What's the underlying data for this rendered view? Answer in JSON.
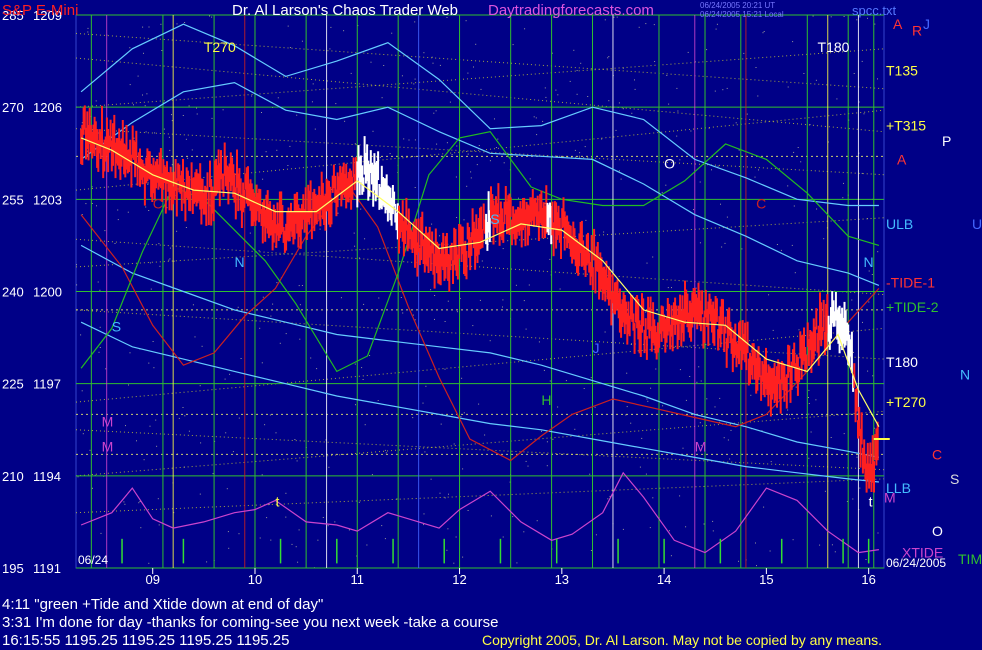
{
  "header": {
    "instrument": "S&P E-Mini",
    "author": "Dr. Al Larson's Chaos Trader Web",
    "site": "Daytradingforecasts.com",
    "stamp_line1": "06/24/2005 20:21 UT",
    "stamp_line2": "06/24/2005 15:21 Local",
    "filename": "spcc.txt"
  },
  "footer": {
    "note1": "4:11 \"green +Tide and Xtide down at end of day\"",
    "note2": "3:31 I'm done for day -thanks for coming-see you next week -take a course",
    "quote": "16:15:55  1195.25 1195.25 1195.25 1195.25",
    "copyright": "Copyright 2005, Dr. Al Larson. May not be copied by any means."
  },
  "colors": {
    "background": "#000087",
    "price_up": "#ff2020",
    "price_white": "#ffffff",
    "moving_average": "#ffff66",
    "band": "#66ccff",
    "tide1": "#cc2020",
    "tide2": "#22bb22",
    "xtide": "#cc44cc",
    "grid": "#2fbf2f",
    "flux_dots": "#cccc33",
    "label_yellow": "#ffff44",
    "label_white": "#ffffff",
    "label_cyan": "#44bbff"
  },
  "chart_data": {
    "type": "candlestick",
    "title": "S&P E-Mini",
    "x_unit": "hour",
    "xlim": [
      8.25,
      16.15
    ],
    "ylim": [
      1191,
      1209
    ],
    "date_left": "06/24",
    "date_right": "06/24/2005",
    "x_ticks": [
      "09",
      "10",
      "11",
      "12",
      "13",
      "14",
      "15",
      "16"
    ],
    "y_ticks_left": [
      "195",
      "210",
      "225",
      "240",
      "255",
      "270",
      "285"
    ],
    "y_ticks_right": [
      "1191",
      "1194",
      "1197",
      "1200",
      "1203",
      "1206",
      "1209"
    ],
    "price": {
      "x": [
        8.3,
        8.5,
        8.7,
        8.9,
        9.1,
        9.3,
        9.5,
        9.7,
        9.9,
        10.1,
        10.3,
        10.5,
        10.7,
        10.9,
        11.1,
        11.3,
        11.5,
        11.7,
        11.9,
        12.1,
        12.3,
        12.5,
        12.7,
        12.9,
        13.1,
        13.3,
        13.5,
        13.7,
        13.9,
        14.1,
        14.3,
        14.5,
        14.7,
        14.9,
        15.1,
        15.3,
        15.5,
        15.7,
        15.8,
        15.9,
        16.0,
        16.1
      ],
      "y": [
        1205.2,
        1204.9,
        1204.6,
        1204.0,
        1203.6,
        1203.4,
        1203.0,
        1203.8,
        1203.2,
        1202.4,
        1202.0,
        1202.6,
        1203.0,
        1203.5,
        1204.0,
        1203.2,
        1201.8,
        1201.3,
        1201.0,
        1201.6,
        1202.4,
        1202.4,
        1202.5,
        1202.3,
        1201.6,
        1201.0,
        1199.8,
        1198.9,
        1198.6,
        1198.9,
        1199.4,
        1199.0,
        1198.4,
        1197.5,
        1196.8,
        1197.6,
        1198.7,
        1199.2,
        1198.6,
        1195.8,
        1193.8,
        1195.2
      ],
      "white_segments": [
        [
          11.0,
          11.4
        ],
        [
          12.25,
          12.3
        ],
        [
          12.85,
          12.9
        ],
        [
          15.6,
          15.85
        ]
      ]
    },
    "moving_average": {
      "x": [
        8.3,
        8.6,
        9.0,
        9.4,
        9.8,
        10.2,
        10.6,
        11.0,
        11.4,
        11.8,
        12.2,
        12.6,
        13.0,
        13.4,
        13.8,
        14.2,
        14.6,
        15.0,
        15.4,
        15.7,
        15.9,
        16.1
      ],
      "y": [
        1205.0,
        1204.6,
        1203.8,
        1203.3,
        1203.2,
        1202.6,
        1202.6,
        1203.6,
        1202.6,
        1201.4,
        1201.6,
        1202.2,
        1202.0,
        1201.0,
        1199.4,
        1199.0,
        1198.9,
        1197.8,
        1197.4,
        1198.6,
        1196.8,
        1195.6
      ]
    },
    "bands": [
      {
        "x": [
          8.3,
          8.8,
          9.3,
          9.8,
          10.3,
          10.8,
          11.3,
          11.8,
          12.3,
          12.8,
          13.3,
          13.8,
          14.3,
          14.8,
          15.3,
          15.8,
          16.1
        ],
        "y": [
          1206.5,
          1207.9,
          1208.7,
          1208.0,
          1207.0,
          1207.5,
          1208.1,
          1206.9,
          1205.3,
          1205.4,
          1206.0,
          1205.6,
          1204.3,
          1203.7,
          1203.0,
          1202.8,
          1202.8
        ]
      },
      {
        "x": [
          8.3,
          8.8,
          9.3,
          9.8,
          10.3,
          10.8,
          11.3,
          11.8,
          12.3,
          12.8,
          13.3,
          13.8,
          14.3,
          14.8,
          15.3,
          15.8,
          16.1
        ],
        "y": [
          1204.3,
          1205.5,
          1206.5,
          1206.8,
          1205.9,
          1205.6,
          1206.0,
          1205.2,
          1204.5,
          1204.4,
          1204.3,
          1203.5,
          1202.5,
          1201.8,
          1201.0,
          1200.6,
          1200.2
        ]
      },
      {
        "x": [
          8.3,
          8.8,
          9.3,
          9.8,
          10.3,
          10.8,
          11.3,
          11.8,
          12.3,
          12.8,
          13.3,
          13.8,
          14.3,
          14.8,
          15.3,
          15.8,
          16.1
        ],
        "y": [
          1201.5,
          1200.6,
          1200.0,
          1199.4,
          1199.0,
          1198.6,
          1198.4,
          1198.2,
          1198.0,
          1197.6,
          1197.1,
          1196.6,
          1196.0,
          1195.6,
          1195.1,
          1194.8,
          1194.6
        ]
      },
      {
        "x": [
          8.3,
          8.8,
          9.3,
          9.8,
          10.3,
          10.8,
          11.3,
          11.8,
          12.3,
          12.8,
          13.3,
          13.8,
          14.3,
          14.8,
          15.3,
          15.8,
          16.1
        ],
        "y": [
          1199.0,
          1198.2,
          1197.8,
          1197.4,
          1197.0,
          1196.6,
          1196.3,
          1196.0,
          1195.7,
          1195.5,
          1195.2,
          1194.9,
          1194.6,
          1194.3,
          1194.1,
          1193.9,
          1193.8
        ]
      }
    ],
    "tide1": {
      "x": [
        8.3,
        8.7,
        9.0,
        9.3,
        9.6,
        9.9,
        10.2,
        10.5,
        10.9,
        11.2,
        11.5,
        11.8,
        12.1,
        12.5,
        12.8,
        13.1,
        13.5,
        13.9,
        14.3,
        14.7,
        15.0,
        15.4,
        15.8,
        16.1
      ],
      "y": [
        1202.5,
        1200.8,
        1198.9,
        1197.6,
        1198.0,
        1199.2,
        1200.1,
        1201.8,
        1203.5,
        1202.1,
        1199.5,
        1197.2,
        1195.2,
        1194.5,
        1195.3,
        1196.0,
        1196.5,
        1196.2,
        1195.9,
        1195.6,
        1196.0,
        1197.4,
        1199.0,
        1200.1
      ]
    },
    "tide2": {
      "x": [
        8.3,
        8.6,
        8.9,
        9.2,
        9.5,
        9.8,
        10.1,
        10.4,
        10.8,
        11.1,
        11.4,
        11.7,
        12.0,
        12.3,
        12.7,
        13.0,
        13.4,
        13.8,
        14.2,
        14.6,
        15.0,
        15.4,
        15.8,
        16.1
      ],
      "y": [
        1197.5,
        1198.8,
        1201.3,
        1203.4,
        1203.0,
        1202.0,
        1201.0,
        1199.6,
        1197.4,
        1197.9,
        1200.6,
        1203.8,
        1205.0,
        1205.2,
        1203.4,
        1203.0,
        1202.8,
        1202.8,
        1203.6,
        1204.8,
        1204.3,
        1203.2,
        1201.8,
        1201.5
      ]
    },
    "xtide": {
      "x": [
        8.3,
        8.6,
        8.8,
        9.0,
        9.2,
        9.5,
        9.8,
        10.0,
        10.2,
        10.5,
        10.8,
        11.0,
        11.3,
        11.5,
        11.8,
        12.0,
        12.3,
        12.6,
        12.9,
        13.1,
        13.4,
        13.6,
        13.8,
        14.1,
        14.4,
        14.7,
        15.0,
        15.3,
        15.6,
        15.9,
        16.1
      ],
      "y": [
        1192.4,
        1192.8,
        1193.6,
        1192.6,
        1192.3,
        1192.5,
        1192.8,
        1192.9,
        1193.2,
        1192.5,
        1192.4,
        1192.2,
        1192.8,
        1192.6,
        1192.3,
        1192.9,
        1193.5,
        1192.5,
        1191.9,
        1192.1,
        1192.8,
        1194.1,
        1193.3,
        1191.9,
        1191.5,
        1192.2,
        1193.6,
        1193.2,
        1192.2,
        1191.5,
        1191.6
      ]
    },
    "grid_x": [
      8.4,
      9.1,
      9.6,
      10.0,
      10.5,
      11.0,
      11.4,
      12.0,
      12.5,
      12.9,
      13.3,
      13.95,
      14.4,
      14.75,
      15.4,
      15.8,
      16.05
    ],
    "vertical_markers": [
      {
        "x": 8.55,
        "color": "#cc44cc"
      },
      {
        "x": 9.2,
        "color": "#ffff44"
      },
      {
        "x": 9.9,
        "color": "#cc2020"
      },
      {
        "x": 10.7,
        "color": "#ffffff"
      },
      {
        "x": 11.6,
        "color": "#4466ff"
      },
      {
        "x": 13.5,
        "color": "#ffffff"
      },
      {
        "x": 14.3,
        "color": "#cc44cc"
      },
      {
        "x": 14.8,
        "color": "#cc2020"
      },
      {
        "x": 15.6,
        "color": "#ffff44"
      },
      {
        "x": 15.9,
        "color": "#ffffff"
      }
    ],
    "spikes_x": [
      8.7,
      9.3,
      10.25,
      10.8,
      11.35,
      11.85,
      12.4,
      12.95,
      13.55,
      14.0,
      14.55,
      15.15,
      15.75,
      16.0
    ],
    "current_price": 1195.2,
    "flux_labels": [
      {
        "text": "T270",
        "x": 9.5,
        "y": 1207.8,
        "color": "#ffff44"
      },
      {
        "text": "T180",
        "x": 15.5,
        "y": 1207.8,
        "color": "#ffffff"
      },
      {
        "text": "N",
        "x": 9.8,
        "y": 1200.8,
        "color": "#44bbff"
      },
      {
        "text": "S",
        "x": 8.6,
        "y": 1198.7,
        "color": "#44bbff"
      },
      {
        "text": "M",
        "x": 8.5,
        "y": 1195.6,
        "color": "#cc44cc"
      },
      {
        "text": "M",
        "x": 8.5,
        "y": 1194.8,
        "color": "#cc44cc"
      },
      {
        "text": "O",
        "x": 14.0,
        "y": 1204.0,
        "color": "#ffffff"
      },
      {
        "text": "H",
        "x": 12.8,
        "y": 1196.3,
        "color": "#2fbf2f"
      },
      {
        "text": "J",
        "x": 13.3,
        "y": 1198.0,
        "color": "#4466ff"
      },
      {
        "text": "C",
        "x": 9.0,
        "y": 1202.7,
        "color": "#cc2020"
      },
      {
        "text": "C",
        "x": 14.9,
        "y": 1202.7,
        "color": "#cc2020"
      },
      {
        "text": "M",
        "x": 14.3,
        "y": 1194.8,
        "color": "#cc44cc"
      },
      {
        "text": "N",
        "x": 15.95,
        "y": 1200.8,
        "color": "#44bbff"
      },
      {
        "text": "t",
        "x": 10.2,
        "y": 1193.0,
        "color": "#ffff44"
      },
      {
        "text": "t",
        "x": 16.0,
        "y": 1193.0,
        "color": "#ffffff"
      },
      {
        "text": "S",
        "x": 12.3,
        "y": 1202.2,
        "color": "#44bbff"
      }
    ],
    "right_labels": [
      {
        "text": "A",
        "y": 1208.7,
        "color": "#ff3333"
      },
      {
        "text": "R",
        "y": 1208.5,
        "color": "#ff3333"
      },
      {
        "text": "J",
        "y": 1208.7,
        "color": "#4466ff"
      },
      {
        "text": "T135",
        "y": 1207.2,
        "color": "#ffff44"
      },
      {
        "text": "+T315",
        "y": 1205.4,
        "color": "#ffff44"
      },
      {
        "text": "P",
        "y": 1204.9,
        "color": "#ffffff"
      },
      {
        "text": "A",
        "y": 1204.3,
        "color": "#ff3333"
      },
      {
        "text": "ULB",
        "y": 1202.2,
        "color": "#44bbff"
      },
      {
        "text": "U",
        "y": 1202.2,
        "color": "#4466ff"
      },
      {
        "text": "-TIDE-1",
        "y": 1200.3,
        "color": "#ff3333"
      },
      {
        "text": "+TIDE-2",
        "y": 1199.5,
        "color": "#2fbf2f"
      },
      {
        "text": "T180",
        "y": 1197.7,
        "color": "#ffffff"
      },
      {
        "text": "N",
        "y": 1197.3,
        "color": "#44bbff"
      },
      {
        "text": "+T270",
        "y": 1196.4,
        "color": "#ffff44"
      },
      {
        "text": "C",
        "y": 1194.7,
        "color": "#ff3333"
      },
      {
        "text": "S",
        "y": 1193.9,
        "color": "#dddddd"
      },
      {
        "text": "LLB",
        "y": 1193.6,
        "color": "#44bbff"
      },
      {
        "text": "M",
        "y": 1193.3,
        "color": "#cc44cc"
      },
      {
        "text": "O",
        "y": 1192.2,
        "color": "#ffffff"
      },
      {
        "text": "XTIDE",
        "y": 1191.5,
        "color": "#cc44cc"
      },
      {
        "text": "TIM",
        "y": 1191.3,
        "color": "#2fbf2f"
      }
    ]
  }
}
